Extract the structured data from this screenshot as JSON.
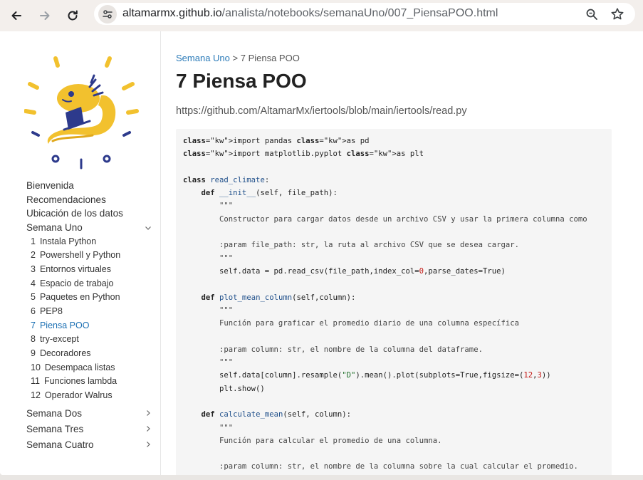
{
  "browser": {
    "url_host": "altamarmx.github.io",
    "url_path": "/analista/notebooks/semanaUno/007_PiensaPOO.html",
    "icons": [
      "back-arrow-icon",
      "forward-arrow-icon",
      "reload-icon",
      "site-settings-icon",
      "zoom-icon",
      "bookmark-star-icon"
    ]
  },
  "sidebar": {
    "top_links": [
      "Bienvenida",
      "Recomendaciones",
      "Ubicación de los datos"
    ],
    "open_section": {
      "label": "Semana Uno",
      "items": [
        {
          "num": "1",
          "label": "Instala Python"
        },
        {
          "num": "2",
          "label": "Powershell y Python"
        },
        {
          "num": "3",
          "label": "Entornos virtuales"
        },
        {
          "num": "4",
          "label": "Espacio de trabajo"
        },
        {
          "num": "5",
          "label": "Paquetes en Python"
        },
        {
          "num": "6",
          "label": "PEP8"
        },
        {
          "num": "7",
          "label": "Piensa POO"
        },
        {
          "num": "8",
          "label": "try-except"
        },
        {
          "num": "9",
          "label": "Decoradores"
        },
        {
          "num": "10",
          "label": "Desempaca listas"
        },
        {
          "num": "11",
          "label": "Funciones lambda"
        },
        {
          "num": "12",
          "label": "Operador Walrus"
        }
      ],
      "active_index": 6
    },
    "collapsed_sections": [
      "Semana Dos",
      "Semana Tres",
      "Semana Cuatro"
    ]
  },
  "main": {
    "breadcrumb_link": "Semana Uno",
    "breadcrumb_sep": ">",
    "breadcrumb_current": "7  Piensa POO",
    "title": "7  Piensa POO",
    "source_link": "https://github.com/AltamarMx/iertools/blob/main/iertools/read.py",
    "code_lines": [
      "import pandas as pd",
      "import matplotlib.pyplot as plt",
      "",
      "class read_climate:",
      "    def __init__(self, file_path):",
      "        \"\"\"",
      "        Constructor para cargar datos desde un archivo CSV y usar la primera columna como",
      "",
      "        :param file_path: str, la ruta al archivo CSV que se desea cargar.",
      "        \"\"\"",
      "        self.data = pd.read_csv(file_path,index_col=0,parse_dates=True)",
      "",
      "    def plot_mean_column(self,column):",
      "        \"\"\"",
      "        Función para graficar el promedio diario de una columna específica",
      "",
      "        :param column: str, el nombre de la columna del dataframe.",
      "        \"\"\"",
      "        self.data[column].resample(\"D\").mean().plot(subplots=True,figsize=(12,3))",
      "        plt.show()",
      "",
      "    def calculate_mean(self, column):",
      "        \"\"\"",
      "        Función para calcular el promedio de una columna.",
      "",
      "        :param column: str, el nombre de la columna sobre la cual calcular el promedio."
    ]
  }
}
